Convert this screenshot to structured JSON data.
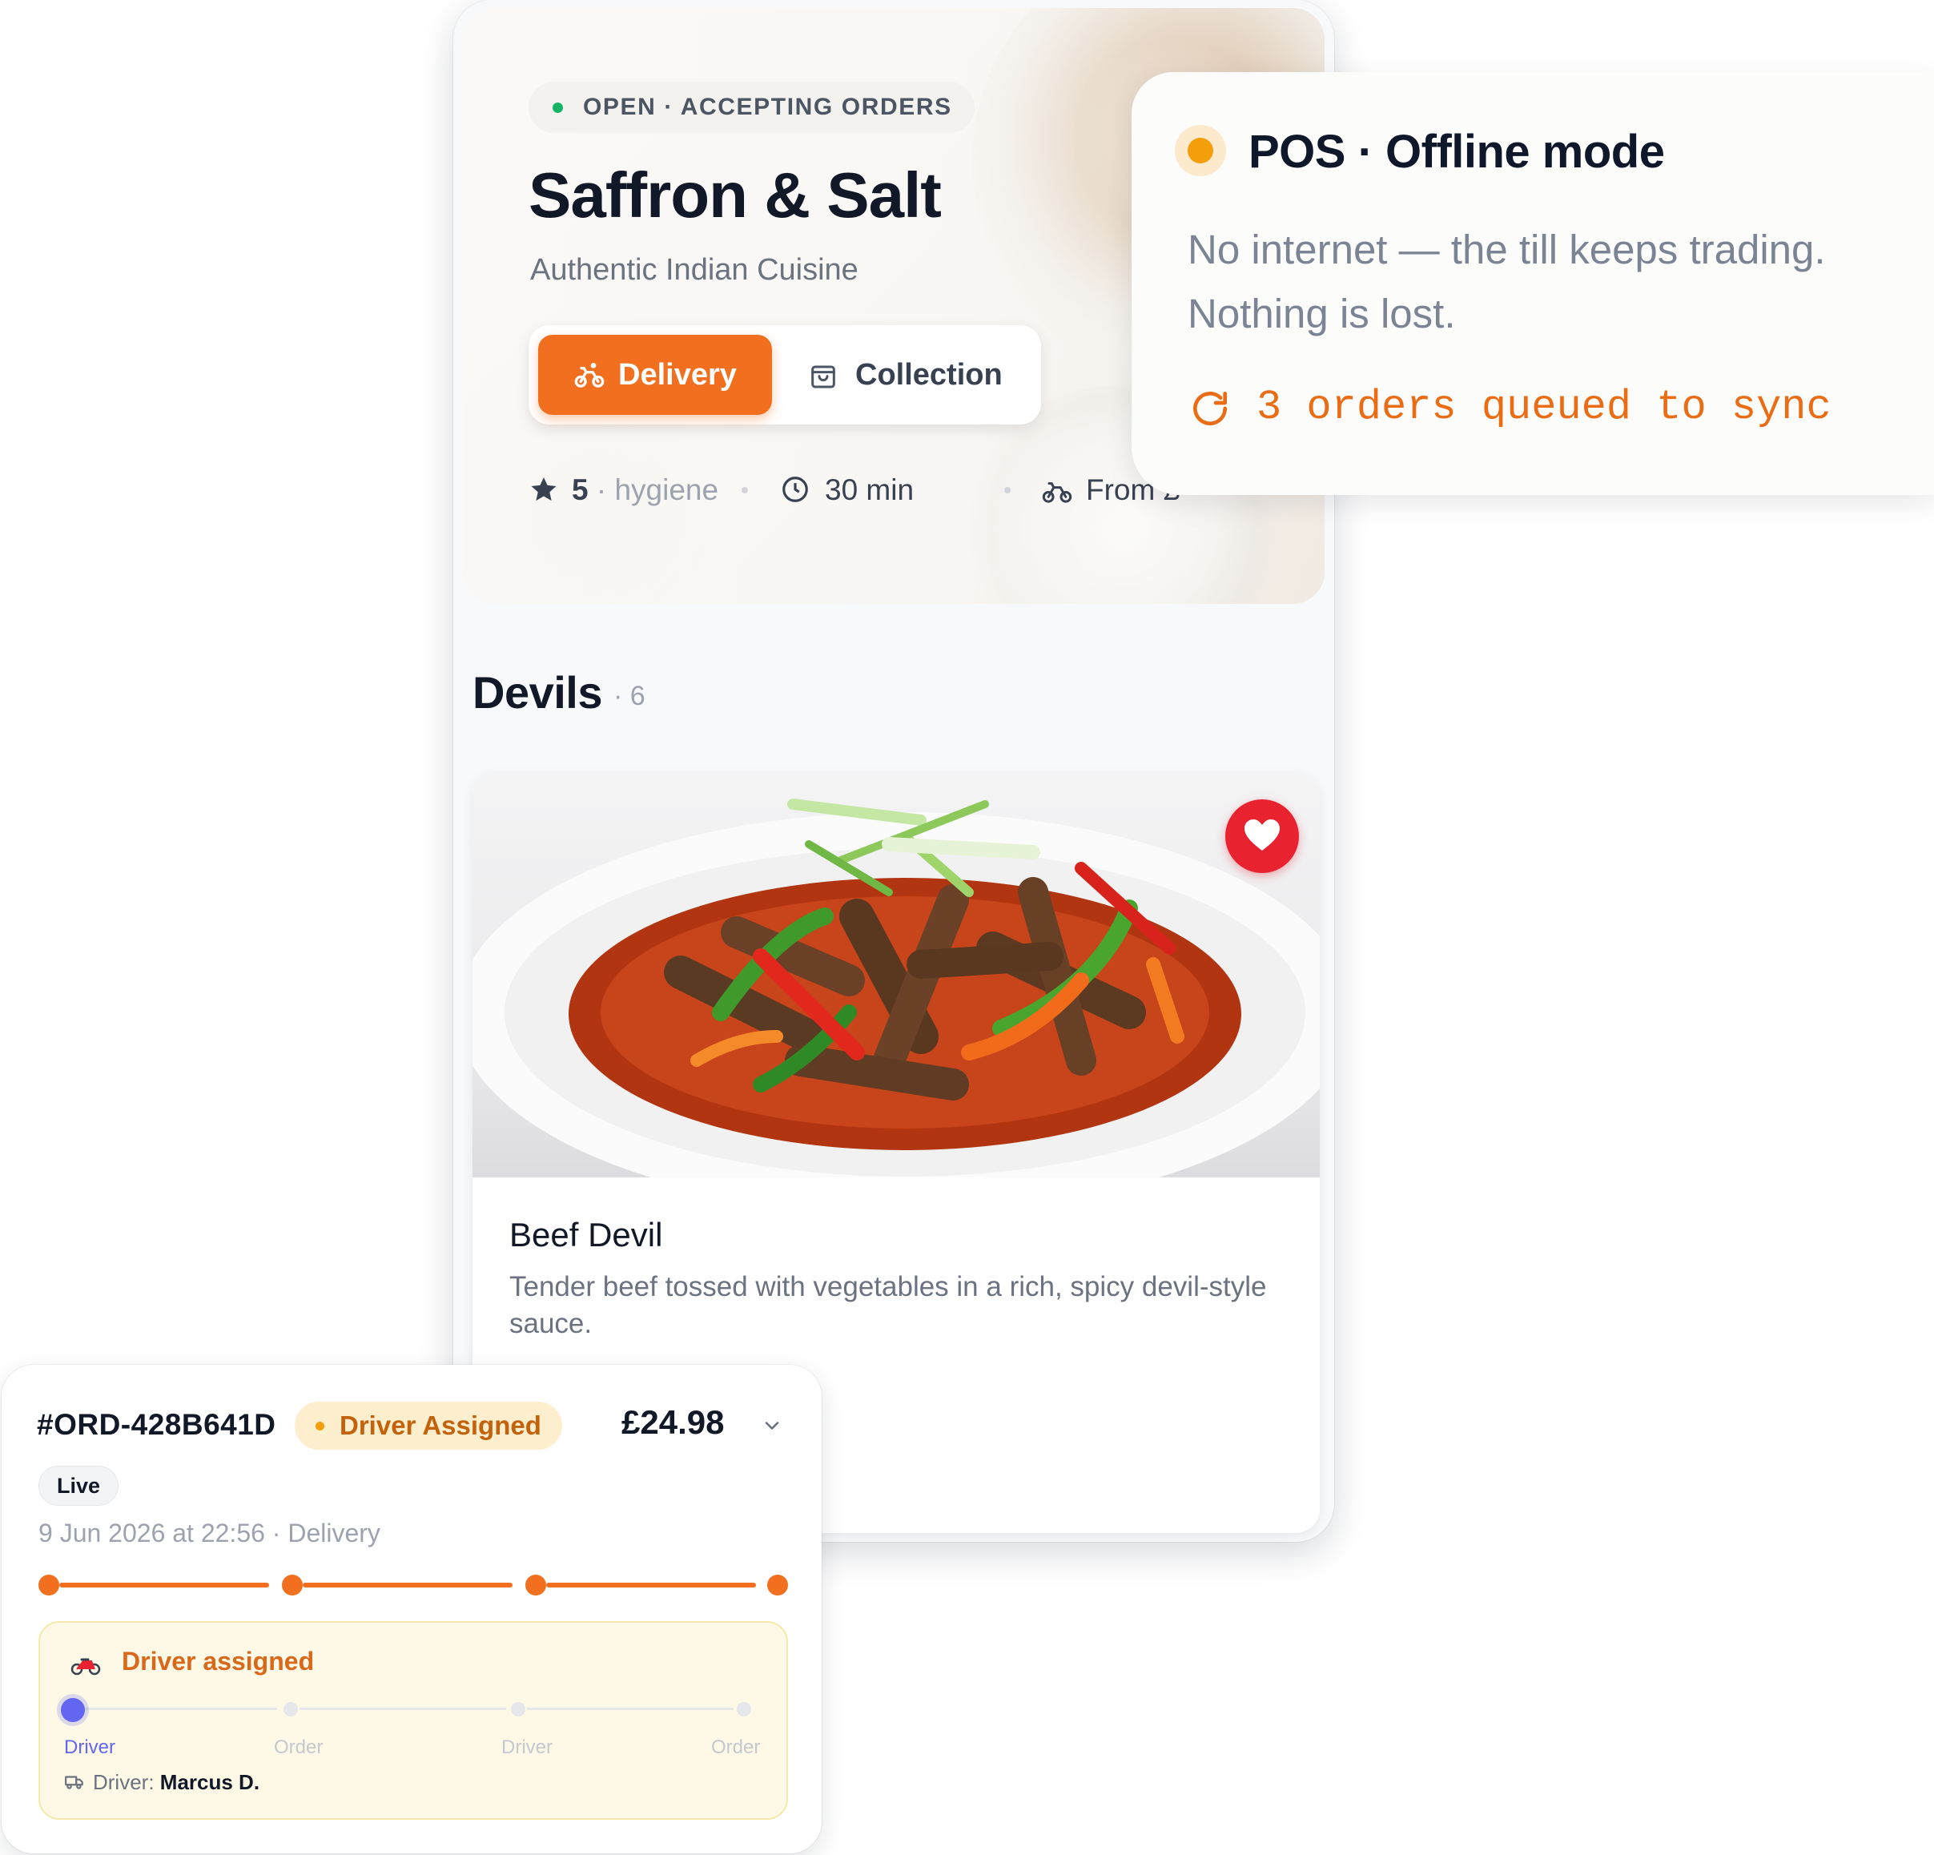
{
  "store": {
    "status": "OPEN · ACCEPTING ORDERS",
    "name": "Saffron & Salt",
    "subtitle": "Authentic Indian Cuisine",
    "modes": {
      "delivery": "Delivery",
      "collection": "Collection",
      "active": "delivery"
    },
    "rating": "5",
    "rating_label": "· hygiene",
    "eta": "30 min",
    "delivery_from": "From £"
  },
  "section": {
    "title": "Devils",
    "count": "· 6"
  },
  "dish": {
    "name": "Beef Devil",
    "description": "Tender beef tossed with vegetables in a rich, spicy devil-style sauce.",
    "favourited": true
  },
  "pos": {
    "title": "POS · Offline mode",
    "body": "No internet — the till keeps trading. Nothing is lost.",
    "sync": "3 orders queued to sync",
    "status_color": "#f59e0b"
  },
  "order": {
    "id": "#ORD-428B641D",
    "status": "Driver Assigned",
    "price": "£24.98",
    "live": "Live",
    "meta": "9 Jun 2026 at 22:56 · Delivery",
    "tracking": {
      "title": "Driver assigned",
      "steps": [
        "Driver",
        "Order",
        "Driver",
        "Order"
      ],
      "current_step": 0,
      "driver_label": "Driver:",
      "driver_name": "Marcus D."
    }
  },
  "colors": {
    "accent": "#f26f1f",
    "heart": "#e8222f",
    "open": "#16b364",
    "track_current": "#6366f1"
  }
}
